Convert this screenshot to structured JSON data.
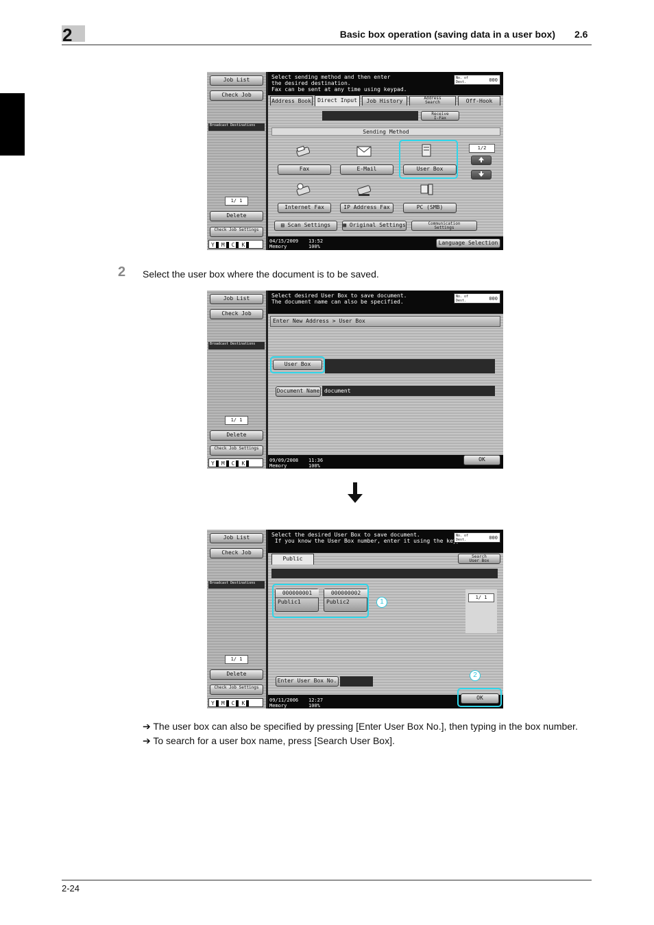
{
  "header": {
    "chapter": "2",
    "title": "Basic box operation (saving data in a user box)",
    "section": "2.6"
  },
  "footer": {
    "page": "2-24"
  },
  "step": {
    "number": "2",
    "text": "Select the user box where the document is to be saved."
  },
  "notes": [
    "The user box can also be specified by pressing [Enter User Box No.], then typing in the box number.",
    "To search for a user box name, press [Search User Box]."
  ],
  "note_arrow": "➔",
  "common": {
    "job_list": "Job List",
    "check_job": "Check Job",
    "broadcast": "Broadcast\nDestinations",
    "delete": "Delete",
    "check_job_settings": "Check Job\nSettings",
    "counter": "1/  1",
    "no_of_dest": "No. of\nDest.",
    "dest_count": "000",
    "toner": {
      "y": "Y",
      "m": "M",
      "c": "C",
      "k": "K"
    }
  },
  "screen1": {
    "message": "Select sending method and then enter\nthe desired destination.\nFax can be sent at any time using keypad.",
    "tabs": [
      "Address Book",
      "Direct Input",
      "Job History",
      "Address\nSearch",
      "Off-Hook"
    ],
    "receive_ifax": "Receive\nI-Fax",
    "sending_method": "Sending Method",
    "methods": [
      "Fax",
      "E-Mail",
      "User Box",
      "Internet Fax",
      "IP Address Fax",
      "PC (SMB)"
    ],
    "page": "1/2",
    "bottom": [
      "Scan Settings",
      "Original Settings",
      "Communication\nSettings"
    ],
    "date": "04/15/2009",
    "time": "13:52",
    "memory": "Memory",
    "mem_pct": "100%",
    "language": "Language Selection"
  },
  "screen2": {
    "message": "Select desired User Box to save document.\nThe document name can also be specified.",
    "breadcrumb": "Enter New Address > User Box",
    "user_box": "User Box",
    "doc_name_label": "Document Name",
    "doc_name_value": "document",
    "date": "09/09/2008",
    "time": "11:36",
    "memory": "Memory",
    "mem_pct": "100%",
    "ok": "OK"
  },
  "screen3": {
    "message": "Select the desired User Box to save document.\n If you know the User Box number, enter it using the keypad.",
    "tab_public": "Public",
    "search_user_box": "Search\nUser Box",
    "boxes": [
      {
        "id": "000000001",
        "name": "Public1"
      },
      {
        "id": "000000002",
        "name": "Public2"
      }
    ],
    "callout1": "1",
    "callout2": "2",
    "page": "1/  1",
    "enter_box_no": "Enter User Box No.",
    "date": "09/11/2006",
    "time": "12:27",
    "memory": "Memory",
    "mem_pct": "100%",
    "ok": "OK"
  }
}
